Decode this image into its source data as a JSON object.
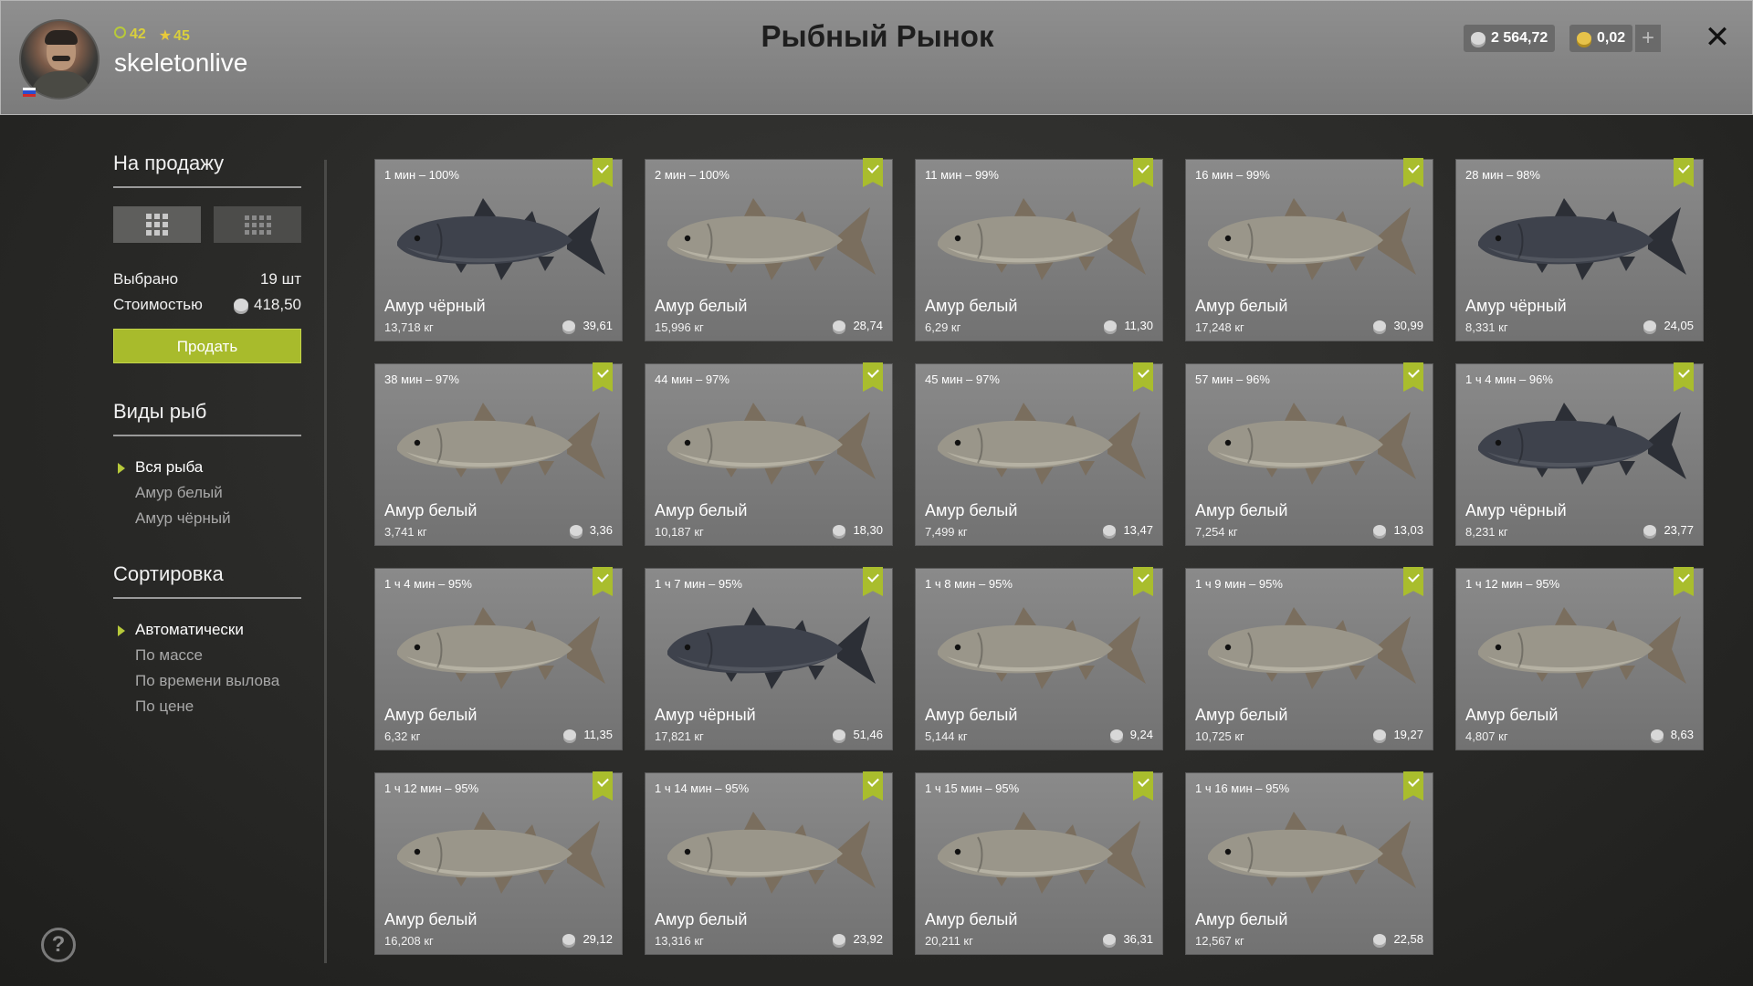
{
  "header": {
    "title": "Рыбный Рынок",
    "level": "42",
    "rank": "45",
    "username": "skeletonlive",
    "silver": "2 564,72",
    "gold": "0,02",
    "plus": "+",
    "close": "✕"
  },
  "sidebar": {
    "for_sale_title": "На продажу",
    "selected_label": "Выбрано",
    "selected_value": "19 шт",
    "cost_label": "Стоимостью",
    "cost_value": "418,50",
    "sell_button": "Продать",
    "species_title": "Виды рыб",
    "species": [
      "Вся рыба",
      "Амур белый",
      "Амур чёрный"
    ],
    "sort_title": "Сортировка",
    "sort": [
      "Автоматически",
      "По массе",
      "По времени вылова",
      "По цене"
    ]
  },
  "help": "?",
  "colors": {
    "accent": "#a9bd2d",
    "white_fish": "#9a968a",
    "black_fish": "#3e424c"
  },
  "fish": [
    {
      "time": "1 мин – 100%",
      "name": "Амур чёрный",
      "weight": "13,718 кг",
      "price": "39,61",
      "kind": "black"
    },
    {
      "time": "2 мин – 100%",
      "name": "Амур белый",
      "weight": "15,996 кг",
      "price": "28,74",
      "kind": "white"
    },
    {
      "time": "11 мин – 99%",
      "name": "Амур белый",
      "weight": "6,29 кг",
      "price": "11,30",
      "kind": "white"
    },
    {
      "time": "16 мин – 99%",
      "name": "Амур белый",
      "weight": "17,248 кг",
      "price": "30,99",
      "kind": "white"
    },
    {
      "time": "28 мин – 98%",
      "name": "Амур чёрный",
      "weight": "8,331 кг",
      "price": "24,05",
      "kind": "black"
    },
    {
      "time": "38 мин – 97%",
      "name": "Амур белый",
      "weight": "3,741 кг",
      "price": "3,36",
      "kind": "white"
    },
    {
      "time": "44 мин – 97%",
      "name": "Амур белый",
      "weight": "10,187 кг",
      "price": "18,30",
      "kind": "white"
    },
    {
      "time": "45 мин – 97%",
      "name": "Амур белый",
      "weight": "7,499 кг",
      "price": "13,47",
      "kind": "white"
    },
    {
      "time": "57 мин – 96%",
      "name": "Амур белый",
      "weight": "7,254 кг",
      "price": "13,03",
      "kind": "white"
    },
    {
      "time": "1 ч 4 мин – 96%",
      "name": "Амур чёрный",
      "weight": "8,231 кг",
      "price": "23,77",
      "kind": "black"
    },
    {
      "time": "1 ч 4 мин – 95%",
      "name": "Амур белый",
      "weight": "6,32 кг",
      "price": "11,35",
      "kind": "white"
    },
    {
      "time": "1 ч 7 мин – 95%",
      "name": "Амур чёрный",
      "weight": "17,821 кг",
      "price": "51,46",
      "kind": "black"
    },
    {
      "time": "1 ч 8 мин – 95%",
      "name": "Амур белый",
      "weight": "5,144 кг",
      "price": "9,24",
      "kind": "white"
    },
    {
      "time": "1 ч 9 мин – 95%",
      "name": "Амур белый",
      "weight": "10,725 кг",
      "price": "19,27",
      "kind": "white"
    },
    {
      "time": "1 ч 12 мин – 95%",
      "name": "Амур белый",
      "weight": "4,807 кг",
      "price": "8,63",
      "kind": "white"
    },
    {
      "time": "1 ч 12 мин – 95%",
      "name": "Амур белый",
      "weight": "16,208 кг",
      "price": "29,12",
      "kind": "white"
    },
    {
      "time": "1 ч 14 мин – 95%",
      "name": "Амур белый",
      "weight": "13,316 кг",
      "price": "23,92",
      "kind": "white"
    },
    {
      "time": "1 ч 15 мин – 95%",
      "name": "Амур белый",
      "weight": "20,211 кг",
      "price": "36,31",
      "kind": "white"
    },
    {
      "time": "1 ч 16 мин – 95%",
      "name": "Амур белый",
      "weight": "12,567 кг",
      "price": "22,58",
      "kind": "white"
    }
  ]
}
